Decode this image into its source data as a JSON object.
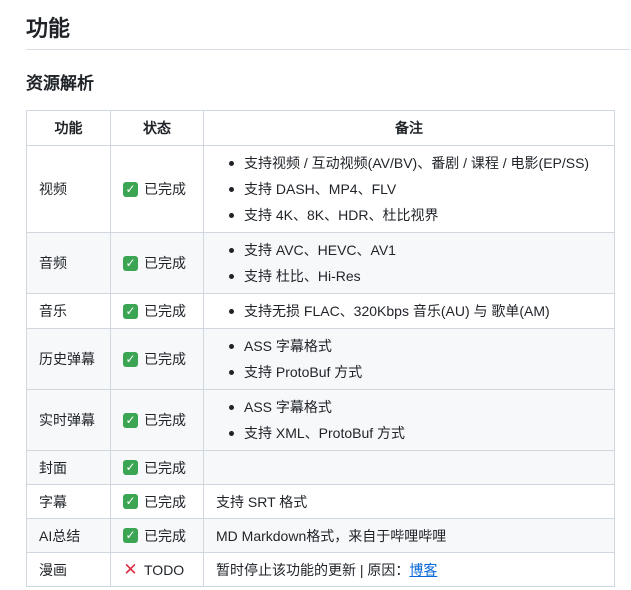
{
  "heading": "功能",
  "section_title": "资源解析",
  "table": {
    "headers": [
      "功能",
      "状态",
      "备注"
    ],
    "done_label": "已完成",
    "todo_label": "TODO",
    "rows": [
      {
        "feature": "视频",
        "notes": [
          "支持视频 / 互动视频(AV/BV)、番剧 / 课程 / 电影(EP/SS)",
          "支持 DASH、MP4、FLV",
          "支持 4K、8K、HDR、杜比视界"
        ]
      },
      {
        "feature": "音频",
        "notes": [
          "支持 AVC、HEVC、AV1",
          "支持 杜比、Hi-Res"
        ]
      },
      {
        "feature": "音乐",
        "notes": [
          "支持无损 FLAC、320Kbps 音乐(AU) 与 歌单(AM)"
        ]
      },
      {
        "feature": "历史弹幕",
        "notes": [
          "ASS 字幕格式",
          "支持 ProtoBuf 方式"
        ]
      },
      {
        "feature": "实时弹幕",
        "notes": [
          "ASS 字幕格式",
          "支持 XML、ProtoBuf 方式"
        ]
      },
      {
        "feature": "封面",
        "note": ""
      },
      {
        "feature": "字幕",
        "note": "支持 SRT 格式"
      },
      {
        "feature": "AI总结",
        "note": "MD Markdown格式，来自于哔哩哔哩"
      },
      {
        "feature": "漫画",
        "note": "暂时停止该功能的更新 | 原因：",
        "link": "博客"
      }
    ]
  },
  "colors": {
    "check": "#3ca554",
    "cross": "#dd2e44",
    "link": "#0969da"
  }
}
